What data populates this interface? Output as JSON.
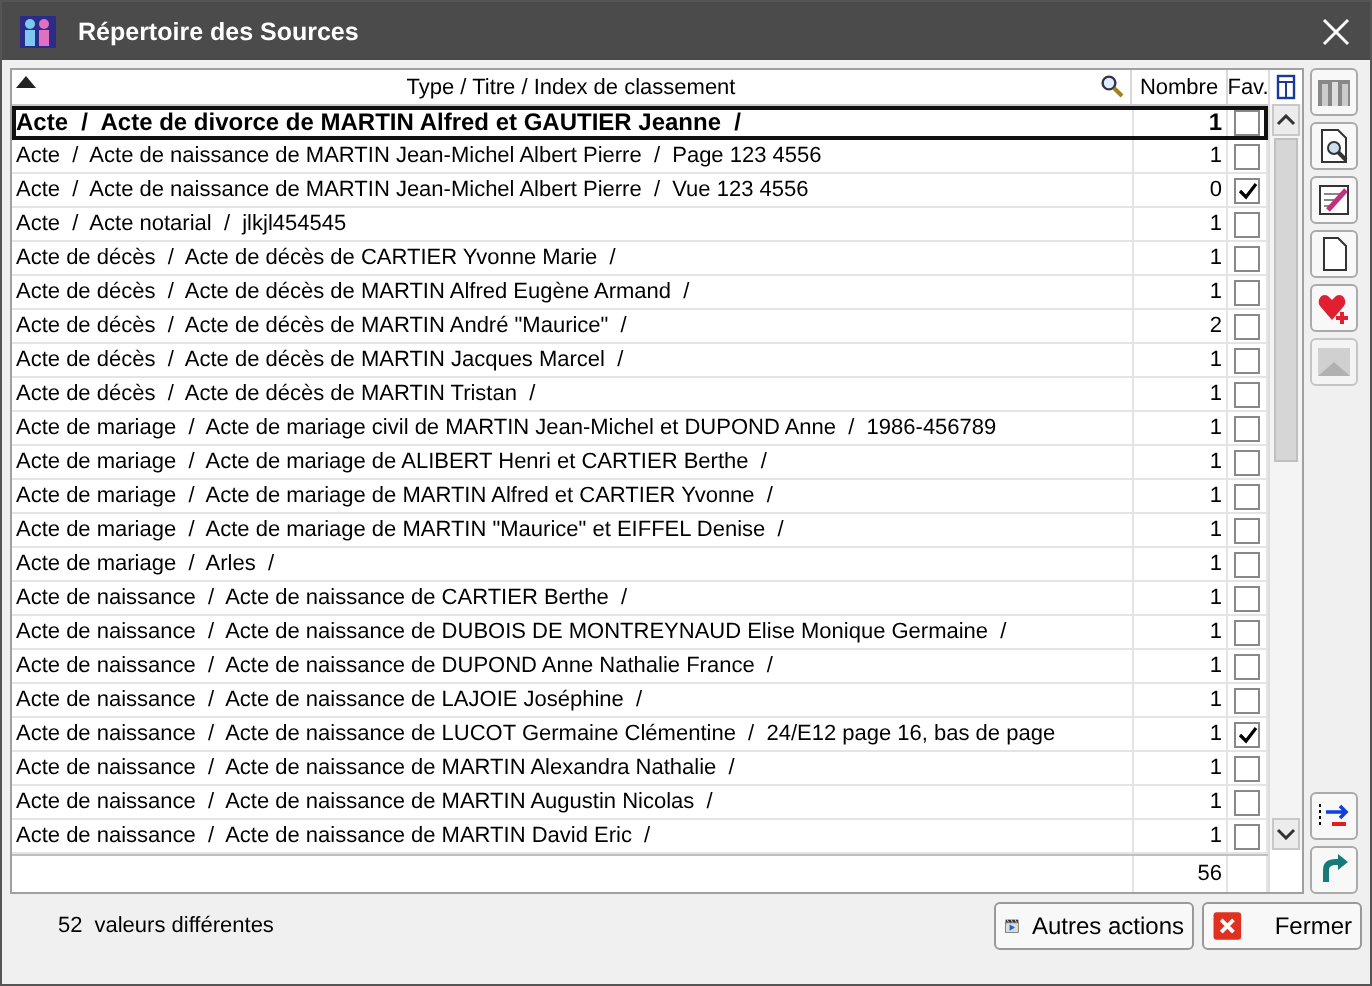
{
  "window": {
    "title": "Répertoire des Sources"
  },
  "table": {
    "columns": [
      "Type / Titre / Index de classement",
      "Nombre",
      "Fav."
    ],
    "rows": [
      {
        "label": "Acte  /  Acte de divorce de MARTIN Alfred et GAUTIER Jeanne  /",
        "count": "1",
        "favorite": false,
        "selected": true
      },
      {
        "label": "Acte  /  Acte de naissance de MARTIN Jean-Michel Albert Pierre  /  Page 123 4556",
        "count": "1",
        "favorite": false,
        "selected": false
      },
      {
        "label": "Acte  /  Acte de naissance de MARTIN Jean-Michel Albert Pierre  /  Vue 123 4556",
        "count": "0",
        "favorite": true,
        "selected": false
      },
      {
        "label": "Acte  /  Acte notarial  /  jlkjl454545",
        "count": "1",
        "favorite": false,
        "selected": false
      },
      {
        "label": "Acte de décès  /  Acte de décès de CARTIER Yvonne Marie  /",
        "count": "1",
        "favorite": false,
        "selected": false
      },
      {
        "label": "Acte de décès  /  Acte de décès de MARTIN Alfred Eugène Armand  /",
        "count": "1",
        "favorite": false,
        "selected": false
      },
      {
        "label": "Acte de décès  /  Acte de décès de MARTIN André \"Maurice\"  /",
        "count": "2",
        "favorite": false,
        "selected": false
      },
      {
        "label": "Acte de décès  /  Acte de décès de MARTIN Jacques Marcel  /",
        "count": "1",
        "favorite": false,
        "selected": false
      },
      {
        "label": "Acte de décès  /  Acte de décès de MARTIN Tristan  /",
        "count": "1",
        "favorite": false,
        "selected": false
      },
      {
        "label": "Acte de mariage  /  Acte de mariage civil de MARTIN Jean-Michel et DUPOND Anne  /  1986-456789",
        "count": "1",
        "favorite": false,
        "selected": false
      },
      {
        "label": "Acte de mariage  /  Acte de mariage de ALIBERT Henri et CARTIER Berthe  /",
        "count": "1",
        "favorite": false,
        "selected": false
      },
      {
        "label": "Acte de mariage  /  Acte de mariage de MARTIN Alfred et CARTIER Yvonne  /",
        "count": "1",
        "favorite": false,
        "selected": false
      },
      {
        "label": "Acte de mariage  /  Acte de mariage de MARTIN \"Maurice\" et EIFFEL Denise  /",
        "count": "1",
        "favorite": false,
        "selected": false
      },
      {
        "label": "Acte de mariage  /  Arles  /",
        "count": "1",
        "favorite": false,
        "selected": false
      },
      {
        "label": "Acte de naissance  /  Acte de naissance de CARTIER Berthe  /",
        "count": "1",
        "favorite": false,
        "selected": false
      },
      {
        "label": "Acte de naissance  /  Acte de naissance de DUBOIS DE MONTREYNAUD Elise Monique Germaine  /",
        "count": "1",
        "favorite": false,
        "selected": false
      },
      {
        "label": "Acte de naissance  /  Acte de naissance de DUPOND Anne Nathalie France  /",
        "count": "1",
        "favorite": false,
        "selected": false
      },
      {
        "label": "Acte de naissance  /  Acte de naissance de LAJOIE Joséphine  /",
        "count": "1",
        "favorite": false,
        "selected": false
      },
      {
        "label": "Acte de naissance  /  Acte de naissance de LUCOT Germaine Clémentine  /  24/E12 page 16, bas de page",
        "count": "1",
        "favorite": true,
        "selected": false
      },
      {
        "label": "Acte de naissance  /  Acte de naissance de MARTIN Alexandra Nathalie  /",
        "count": "1",
        "favorite": false,
        "selected": false
      },
      {
        "label": "Acte de naissance  /  Acte de naissance de MARTIN Augustin Nicolas  /",
        "count": "1",
        "favorite": false,
        "selected": false
      },
      {
        "label": "Acte de naissance  /  Acte de naissance de MARTIN David Eric  /",
        "count": "1",
        "favorite": false,
        "selected": false
      }
    ],
    "total": "56"
  },
  "footer": {
    "count": "52",
    "label": "valeurs différentes"
  },
  "buttons": [
    {
      "label": "Autres actions",
      "kind": "actions"
    },
    {
      "label": "Fermer",
      "kind": "close"
    }
  ]
}
